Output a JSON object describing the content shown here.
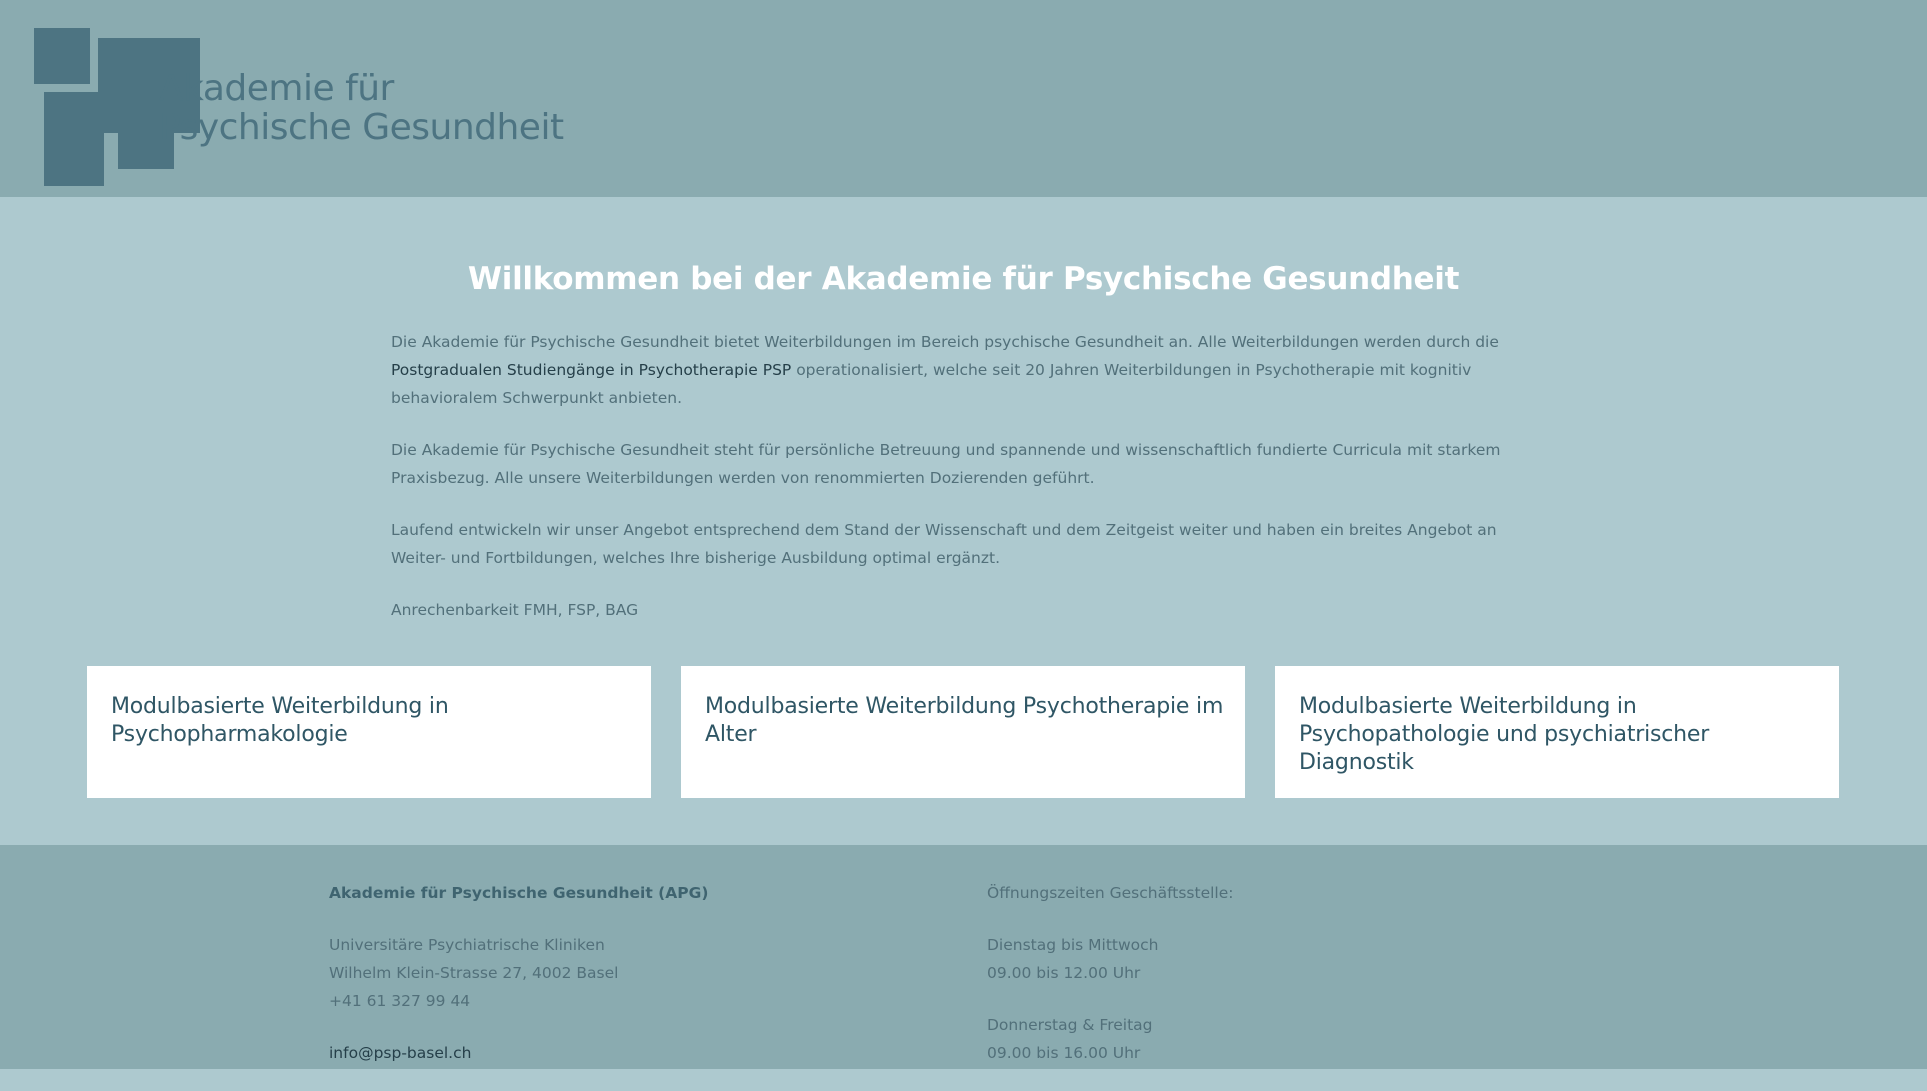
{
  "header": {
    "logo_line1": "Akademie für",
    "logo_line2": "Psychische Gesundheit"
  },
  "main": {
    "title": "Willkommen bei der Akademie für Psychische Gesundheit",
    "p1_before": "Die Akademie für Psychische Gesundheit bietet Weiterbildungen im Bereich psychische Gesundheit an. Alle Weiterbildungen werden durch die ",
    "p1_link": "Postgradualen Studiengänge in Psychotherapie PSP",
    "p1_after": " operationalisiert, welche seit 20 Jahren Weiterbildungen in Psychotherapie mit kognitiv behavioralem Schwerpunkt anbieten.",
    "p2": "Die Akademie für Psychische Gesundheit steht für persönliche Betreuung und spannende und wissenschaftlich fundierte Curricula mit starkem Praxisbezug. Alle unsere Weiterbildungen werden von renommierten Dozierenden geführt.",
    "p3": "Laufend entwickeln wir unser Angebot entsprechend dem Stand der Wissenschaft und dem Zeitgeist weiter und haben ein breites Angebot an Weiter- und Fortbildungen, welches Ihre bisherige Ausbildung optimal ergänzt.",
    "p4": "Anrechenbarkeit FMH, FSP, BAG"
  },
  "cards": [
    {
      "title": "Modulbasierte Weiterbildung in Psychopharmakologie"
    },
    {
      "title": "Modulbasierte Weiterbildung Psychotherapie im Alter"
    },
    {
      "title": "Modulbasierte Weiterbildung in Psychopathologie und psychiatrischer Diagnostik"
    }
  ],
  "footer": {
    "org": "Akademie für Psychische Gesundheit (APG)",
    "address1": "Universitäre Psychiatrische Kliniken",
    "address2": "Wilhelm Klein-Strasse 27, 4002 Basel",
    "phone": "+41 61 327 99 44",
    "email": "info@psp-basel.ch",
    "hours_title": "Öffnungszeiten Geschäftsstelle:",
    "days1": "Dienstag bis Mittwoch",
    "time1": "09.00 bis 12.00 Uhr",
    "days2": "Donnerstag & Freitag",
    "time2": "09.00 bis 16.00 Uhr"
  },
  "colors": {
    "header_bg": "#8aabb0",
    "main_bg": "#adc9cf",
    "logo": "#4d7482",
    "card_title": "#2f5665",
    "text": "#52707a"
  }
}
